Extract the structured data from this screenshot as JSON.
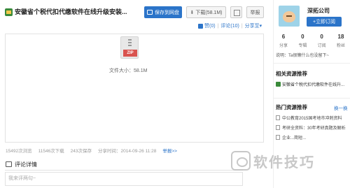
{
  "doc": {
    "title": "安徽省个税代扣代缴软件在线升级安装...",
    "save_label": "保存到网盘",
    "download_label": "下载(58.1M)",
    "report_label": "举报"
  },
  "votes": {
    "likes": "赞(0)",
    "comments": "评论(10)",
    "share": "分享至▾"
  },
  "preview": {
    "file_type": "ZIP",
    "file_size": "文件大小：58.1M"
  },
  "stats": {
    "views": "15492次浏览",
    "downloads": "11546次下载",
    "saves": "243次保存",
    "shared_time": "分享时间：2014-09-26 11:28",
    "report": "举报>>"
  },
  "comments": {
    "title": "评论详情",
    "placeholder": "我来评两句~"
  },
  "sidebar": {
    "company": "深拓公司",
    "follow_label": "+立即订阅",
    "counts": [
      {
        "value": "6",
        "label": "分享"
      },
      {
        "value": "0",
        "label": "专辑"
      },
      {
        "value": "0",
        "label": "订阅"
      },
      {
        "value": "18",
        "label": "粉丝"
      }
    ],
    "bio": "说明：Ta很懒什么也没留下~",
    "related_title": "相关资源推荐",
    "related_items": [
      "安徽省个税代扣代缴软件在线升..."
    ],
    "hot_title": "热门资源推荐",
    "hot_swap": "换一换",
    "hot_items": [
      "中公教育2015国考地市冲刺资料",
      "考研全资料：30年考研真题及解析",
      "企业...简短..."
    ]
  },
  "watermark": {
    "text": "软件技巧"
  }
}
